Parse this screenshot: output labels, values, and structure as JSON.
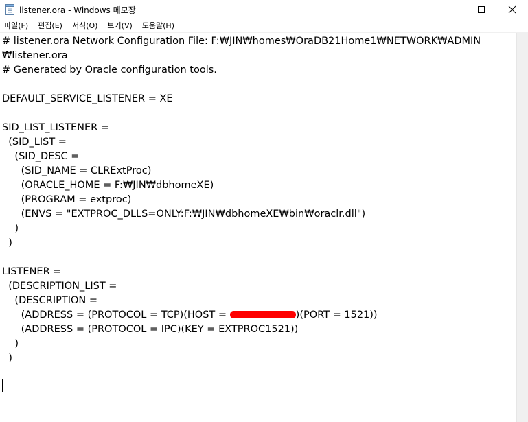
{
  "window": {
    "title": "listener.ora - Windows 메모장",
    "icon": "notepad-icon",
    "controls": [
      "minimize-icon",
      "maximize-icon",
      "close-icon"
    ]
  },
  "menu": [
    {
      "label": "파일(F)"
    },
    {
      "label": "편집(E)"
    },
    {
      "label": "서식(O)"
    },
    {
      "label": "보기(V)"
    },
    {
      "label": "도움말(H)"
    }
  ],
  "editor": {
    "lines": [
      "# listener.ora Network Configuration File: F:₩JIN₩homes₩OraDB21Home1₩NETWORK₩ADMIN",
      "₩listener.ora",
      "# Generated by Oracle configuration tools.",
      "",
      "DEFAULT_SERVICE_LISTENER = XE",
      "",
      "SID_LIST_LISTENER =",
      "  (SID_LIST =",
      "    (SID_DESC =",
      "      (SID_NAME = CLRExtProc)",
      "      (ORACLE_HOME = F:₩JIN₩dbhomeXE)",
      "      (PROGRAM = extproc)",
      "      (ENVS = \"EXTPROC_DLLS=ONLY:F:₩JIN₩dbhomeXE₩bin₩oraclr.dll\")",
      "    )",
      "  )",
      "",
      "LISTENER =",
      "  (DESCRIPTION_LIST =",
      "    (DESCRIPTION =",
      "",
      "      (ADDRESS = (PROTOCOL = IPC)(KEY = EXTPROC1521))",
      "    )",
      "  )"
    ],
    "address_tcp_prefix": "      (ADDRESS = (PROTOCOL = TCP)(HOST = ",
    "address_tcp_suffix": ")(PORT = 1521))",
    "redaction_color": "#ff0000"
  }
}
